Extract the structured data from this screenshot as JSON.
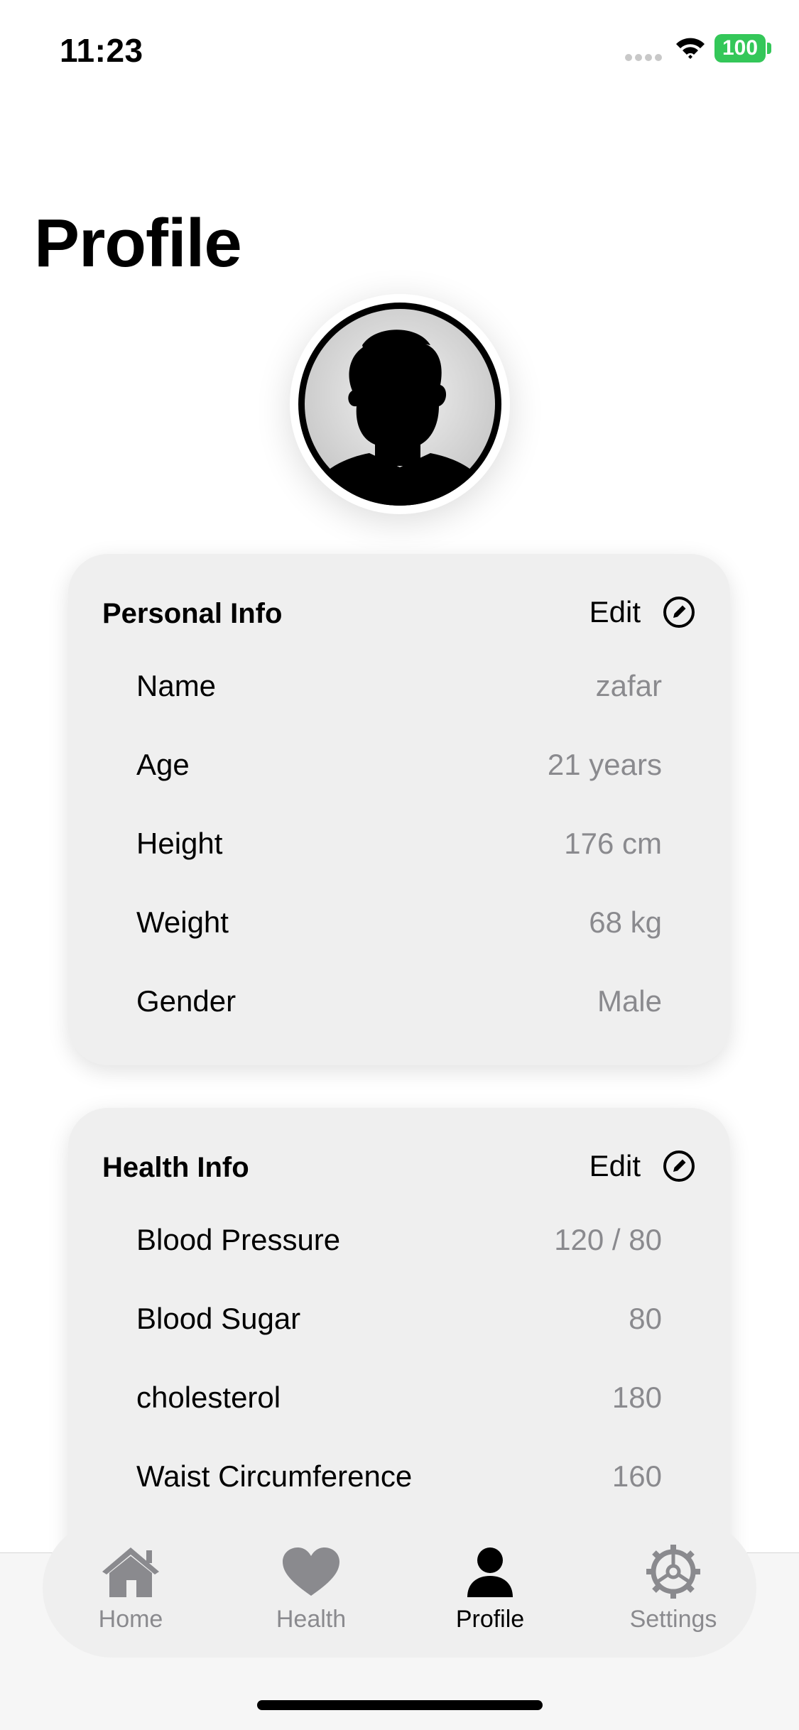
{
  "status_bar": {
    "time": "11:23",
    "battery": "100",
    "battery_color": "#34c759"
  },
  "page": {
    "title": "Profile"
  },
  "avatar": {
    "icon": "person-silhouette-icon"
  },
  "personal_info": {
    "title": "Personal Info",
    "edit_label": "Edit",
    "rows": [
      {
        "label": "Name",
        "value": "zafar"
      },
      {
        "label": "Age",
        "value": "21 years"
      },
      {
        "label": "Height",
        "value": "176 cm"
      },
      {
        "label": "Weight",
        "value": "68 kg"
      },
      {
        "label": "Gender",
        "value": "Male"
      }
    ]
  },
  "health_info": {
    "title": "Health Info",
    "edit_label": "Edit",
    "rows": [
      {
        "label": "Blood Pressure",
        "value": "120 / 80"
      },
      {
        "label": "Blood Sugar",
        "value": "80"
      },
      {
        "label": "cholesterol",
        "value": "180"
      },
      {
        "label": "Waist Circumference",
        "value": "160"
      }
    ]
  },
  "tab_bar": {
    "active": "Profile",
    "active_color": "#000000",
    "inactive_color": "#8a8a8e",
    "tabs": [
      {
        "label": "Home",
        "icon": "house-icon"
      },
      {
        "label": "Health",
        "icon": "heart-icon"
      },
      {
        "label": "Profile",
        "icon": "person-icon"
      },
      {
        "label": "Settings",
        "icon": "gear-icon"
      }
    ]
  }
}
